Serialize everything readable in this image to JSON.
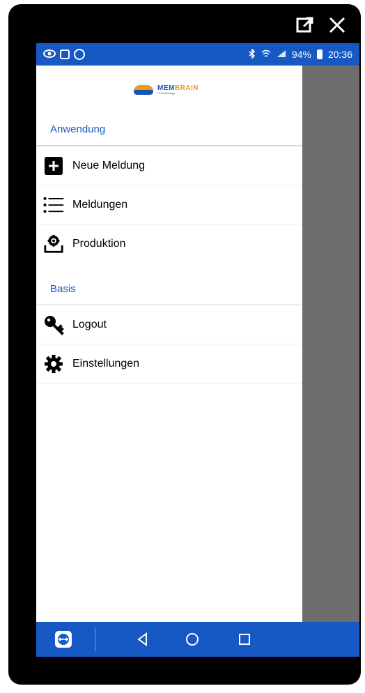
{
  "window": {
    "external_icon": "external-link-icon",
    "close_icon": "close-icon"
  },
  "statusbar": {
    "battery": "94%",
    "time": "20:36",
    "icons": [
      "eye-icon",
      "square-icon",
      "at-icon",
      "bluetooth-icon",
      "wifi-icon",
      "signal-icon",
      "battery-icon"
    ]
  },
  "drawer": {
    "logo": {
      "title_part1": "MEM",
      "title_part2": "BRAIN",
      "subtitle": "IT-Technology"
    },
    "sections": [
      {
        "title": "Anwendung",
        "items": [
          {
            "label": "Neue Meldung",
            "icon": "plus-square-icon"
          },
          {
            "label": "Meldungen",
            "icon": "list-icon"
          },
          {
            "label": "Produktion",
            "icon": "production-gear-icon"
          }
        ]
      },
      {
        "title": "Basis",
        "items": [
          {
            "label": "Logout",
            "icon": "key-icon"
          },
          {
            "label": "Einstellungen",
            "icon": "gear-icon"
          }
        ]
      }
    ]
  },
  "navbar": {
    "icons": [
      "teamviewer-icon",
      "back-icon",
      "home-icon",
      "recents-icon"
    ]
  },
  "colors": {
    "primary": "#1659c5",
    "accent": "#f09a1b",
    "scrim": "#6d6d6d"
  }
}
